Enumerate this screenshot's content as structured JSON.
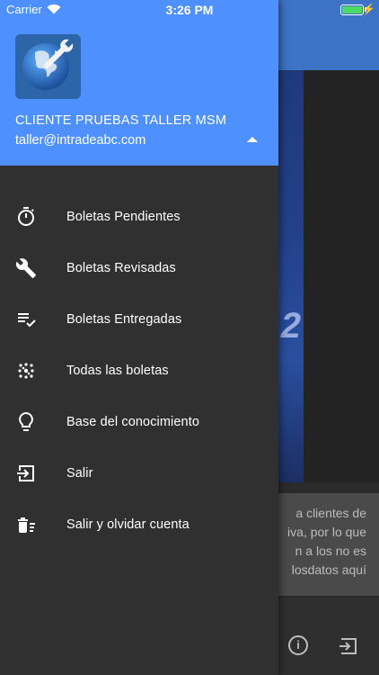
{
  "status_bar": {
    "carrier": "Carrier",
    "time": "3:26 PM",
    "battery_level": 1.0
  },
  "drawer": {
    "header": {
      "user_name": "CLIENTE PRUEBAS TALLER MSM",
      "user_email": "taller@intradeabc.com",
      "logo_icon": "globe-wrench-icon"
    },
    "menu": [
      {
        "label": "Boletas Pendientes",
        "icon": "timer-icon"
      },
      {
        "label": "Boletas Revisadas",
        "icon": "wrench-icon"
      },
      {
        "label": "Boletas Entregadas",
        "icon": "playlist-check-icon"
      },
      {
        "label": "Todas las boletas",
        "icon": "dots-grid-icon"
      },
      {
        "label": "Base del conocimiento",
        "icon": "lightbulb-icon"
      },
      {
        "label": "Salir",
        "icon": "exit-icon"
      },
      {
        "label": "Salir y olvidar cuenta",
        "icon": "delete-sweep-icon"
      }
    ]
  },
  "background": {
    "info_lines": [
      "a clientes de",
      "iva, por lo que",
      "n a los no es",
      "losdatos aquí"
    ]
  },
  "colors": {
    "drawer_header": "#4d90fe",
    "drawer_body": "#303030",
    "app_header": "#3c73c7",
    "text": "#ffffff"
  }
}
